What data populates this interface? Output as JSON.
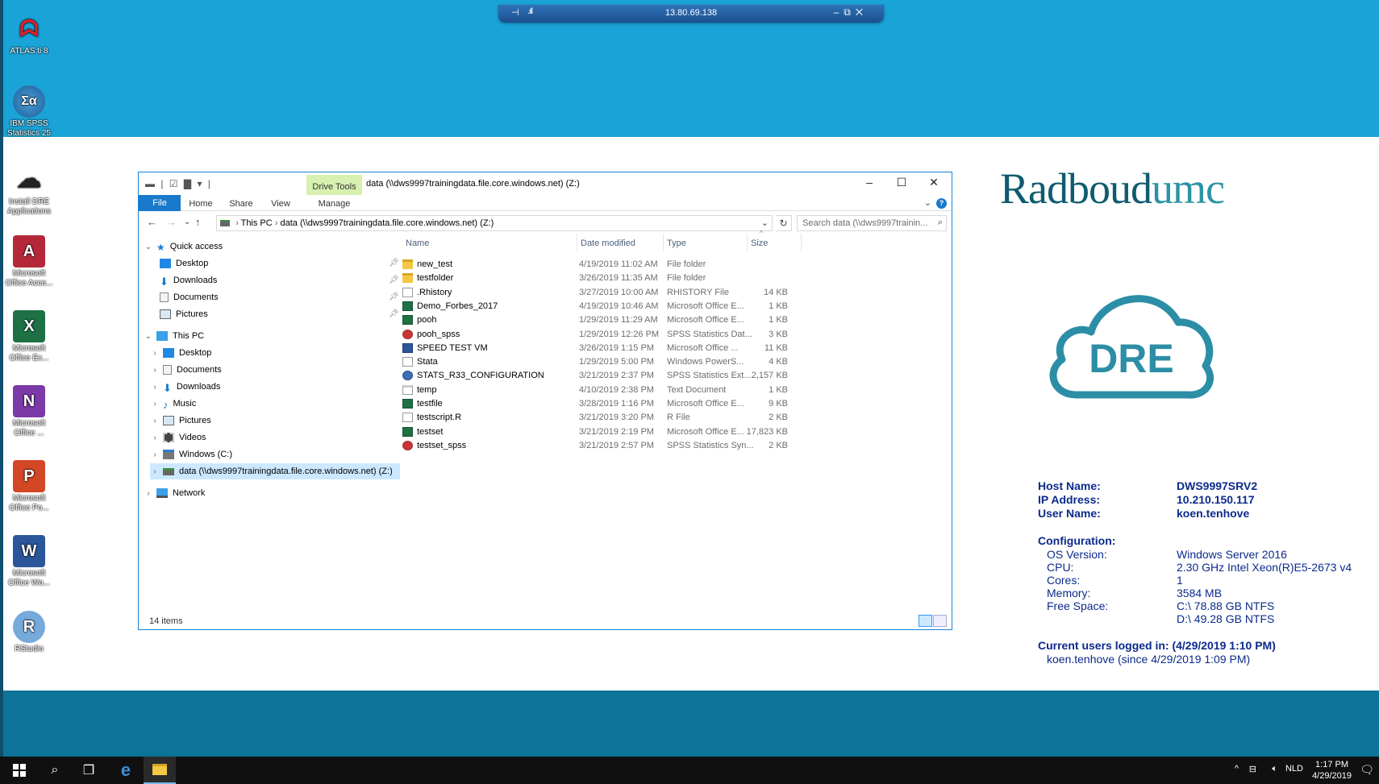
{
  "rdp": {
    "ip": "13.80.69.138"
  },
  "desktop_icons": [
    {
      "line1": "ATLAS.ti 8",
      "line2": "",
      "icon": "atlas-ti-icon"
    },
    {
      "line1": "IBM SPSS",
      "line2": "Statistics 25",
      "icon": "spss-icon"
    },
    {
      "line1": "Install DRE",
      "line2": "Applications",
      "icon": "cloud-install-icon"
    },
    {
      "line1": "Microsoft",
      "line2": "Office Acce...",
      "icon": "access-icon"
    },
    {
      "line1": "Microsoft",
      "line2": "Office Ex...",
      "icon": "excel-icon"
    },
    {
      "line1": "Microsoft",
      "line2": "Office ...",
      "icon": "onenote-icon"
    },
    {
      "line1": "Microsoft",
      "line2": "Office Po...",
      "icon": "powerpoint-icon"
    },
    {
      "line1": "Microsoft",
      "line2": "Office Wo...",
      "icon": "word-icon"
    },
    {
      "line1": "RStudio",
      "line2": "",
      "icon": "rstudio-icon"
    }
  ],
  "explorer": {
    "drive_tools": "Drive Tools",
    "title": "data (\\\\dws9997trainingdata.file.core.windows.net) (Z:)",
    "tabs": [
      "File",
      "Home",
      "Share",
      "View",
      "Manage"
    ],
    "breadcrumb": [
      "This PC",
      "data (\\\\dws9997trainingdata.file.core.windows.net) (Z:)"
    ],
    "search_placeholder": "Search data (\\\\dws9997trainin...",
    "nav": {
      "quick_access": "Quick access",
      "quick_items": [
        "Desktop",
        "Downloads",
        "Documents",
        "Pictures"
      ],
      "this_pc": "This PC",
      "pc_items": [
        "Desktop",
        "Documents",
        "Downloads",
        "Music",
        "Pictures",
        "Videos",
        "Windows (C:)",
        "data (\\\\dws9997trainingdata.file.core.windows.net) (Z:)"
      ],
      "network": "Network"
    },
    "columns": {
      "name": "Name",
      "date": "Date modified",
      "type": "Type",
      "size": "Size"
    },
    "files": [
      {
        "name": "new_test",
        "date": "4/19/2019 11:02 AM",
        "type": "File folder",
        "size": "",
        "kind": "folder"
      },
      {
        "name": "testfolder",
        "date": "3/26/2019 11:35 AM",
        "type": "File folder",
        "size": "",
        "kind": "folder"
      },
      {
        "name": ".Rhistory",
        "date": "3/27/2019 10:00 AM",
        "type": "RHISTORY File",
        "size": "14 KB",
        "kind": "blank"
      },
      {
        "name": "Demo_Forbes_2017",
        "date": "4/19/2019 10:46 AM",
        "type": "Microsoft Office E...",
        "size": "1 KB",
        "kind": "excel"
      },
      {
        "name": "pooh",
        "date": "1/29/2019 11:29 AM",
        "type": "Microsoft Office E...",
        "size": "1 KB",
        "kind": "excel"
      },
      {
        "name": "pooh_spss",
        "date": "1/29/2019 12:26 PM",
        "type": "SPSS Statistics Dat...",
        "size": "3 KB",
        "kind": "spss"
      },
      {
        "name": "SPEED TEST VM",
        "date": "3/26/2019 1:15 PM",
        "type": "Microsoft Office ...",
        "size": "11 KB",
        "kind": "word"
      },
      {
        "name": "Stata",
        "date": "1/29/2019 5:00 PM",
        "type": "Windows PowerS...",
        "size": "4 KB",
        "kind": "ps"
      },
      {
        "name": "STATS_R33_CONFIGURATION",
        "date": "3/21/2019 2:37 PM",
        "type": "SPSS Statistics Ext...",
        "size": "2,157 KB",
        "kind": "ext"
      },
      {
        "name": "temp",
        "date": "4/10/2019 2:38 PM",
        "type": "Text Document",
        "size": "1 KB",
        "kind": "txt"
      },
      {
        "name": "testfile",
        "date": "3/28/2019 1:16 PM",
        "type": "Microsoft Office E...",
        "size": "9 KB",
        "kind": "excel"
      },
      {
        "name": "testscript.R",
        "date": "3/21/2019 3:20 PM",
        "type": "R File",
        "size": "2 KB",
        "kind": "blank"
      },
      {
        "name": "testset",
        "date": "3/21/2019 2:19 PM",
        "type": "Microsoft Office E...",
        "size": "17,823 KB",
        "kind": "excel"
      },
      {
        "name": "testset_spss",
        "date": "3/21/2019 2:57 PM",
        "type": "SPSS Statistics Syn...",
        "size": "2 KB",
        "kind": "spss"
      }
    ],
    "status": "14 items"
  },
  "brand": {
    "name": "Radboud",
    "suffix": "umc",
    "cloud_text": "DRE"
  },
  "sysinfo": {
    "host_label": "Host Name:",
    "host": "DWS9997SRV2",
    "ip_label": "IP Address:",
    "ip": "10.210.150.117",
    "user_label": "User Name:",
    "user": "koen.tenhove",
    "config_label": "Configuration:",
    "os_label": "OS Version:",
    "os": "Windows Server 2016",
    "cpu_label": "CPU:",
    "cpu": "2.30 GHz Intel Xeon(R)E5-2673 v4",
    "cores_label": "Cores:",
    "cores": "1",
    "mem_label": "Memory:",
    "mem": "3584 MB",
    "free_label": "Free Space:",
    "free_c": "C:\\ 78.88 GB NTFS",
    "free_d": "D:\\ 49.28 GB NTFS",
    "users_label": "Current users logged in:  (4/29/2019 1:10 PM)",
    "users_value": "koen.tenhove (since 4/29/2019 1:09 PM)"
  },
  "taskbar": {
    "lang": "NLD",
    "time": "1:17 PM",
    "date": "4/29/2019"
  }
}
